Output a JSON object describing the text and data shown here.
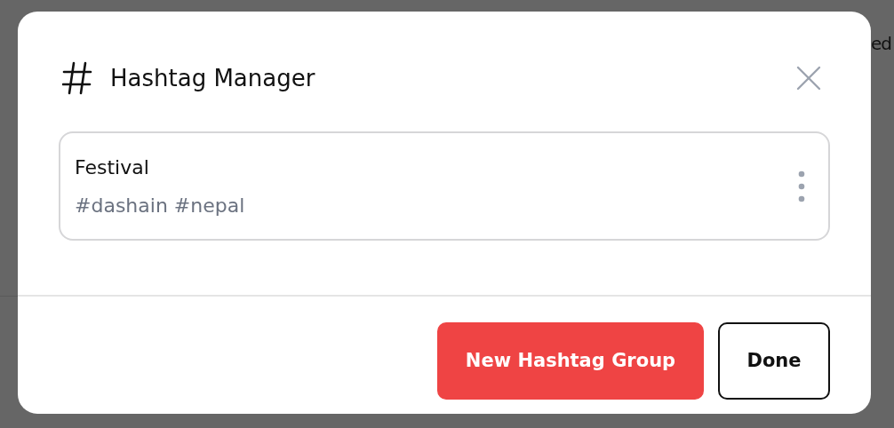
{
  "background": {
    "partial_text": "ed"
  },
  "modal": {
    "title": "Hashtag Manager",
    "groups": [
      {
        "name": "Festival",
        "tags": "#dashain #nepal"
      }
    ],
    "buttons": [
      {
        "label": "New Hashtag Group",
        "kind": "primary"
      },
      {
        "label": "Done",
        "kind": "outline"
      }
    ]
  }
}
